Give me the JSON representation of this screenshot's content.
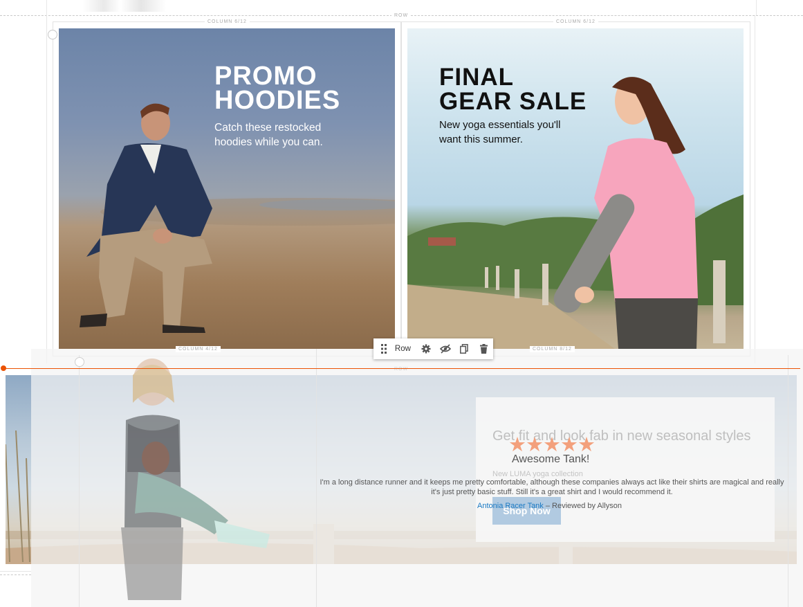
{
  "stage": {
    "row_label": "ROW",
    "top_columns": [
      "COLUMN 6/12",
      "COLUMN 6/12"
    ],
    "bottom_columns": [
      "COLUMN 4/12",
      "COLUMN 8/12"
    ],
    "bottom_row_label": "ROW"
  },
  "banners": [
    {
      "title_line1": "PROMO",
      "title_line2": "HOODIES",
      "subtitle_line1": "Catch these restocked",
      "subtitle_line2": "hoodies while you can.",
      "image": "man-crouching-on-beach-photo"
    },
    {
      "title_line1": "FINAL",
      "title_line2": "GEAR SALE",
      "subtitle_line1": "New yoga essentials you'll",
      "subtitle_line2": "want this summer.",
      "image": "woman-with-yoga-mat-photo"
    }
  ],
  "toolbar": {
    "label": "Row",
    "icons": [
      "drag-handle-icon",
      "settings-gear-icon",
      "hide-eye-icon",
      "duplicate-icon",
      "trash-icon"
    ]
  },
  "bottom_banner": {
    "heading": "Get fit and look fab in new seasonal styles",
    "collection": "New LUMA yoga collection",
    "button": "Shop Now"
  },
  "review": {
    "stars": "★★★★★",
    "rating": 5,
    "title": "Awesome Tank!",
    "text": "I'm a long distance runner and it keeps me pretty comfortable, although these companies always act like their shirts are magical and really it's just pretty basic stuff. Still it's a great shirt and I would recommend it.",
    "product": "Antonia Racer Tank",
    "reviewed_by": "– Reviewed by Allyson"
  },
  "colors": {
    "accent_orange": "#eb5202",
    "star": "#f3a07c",
    "link": "#1979c3"
  }
}
